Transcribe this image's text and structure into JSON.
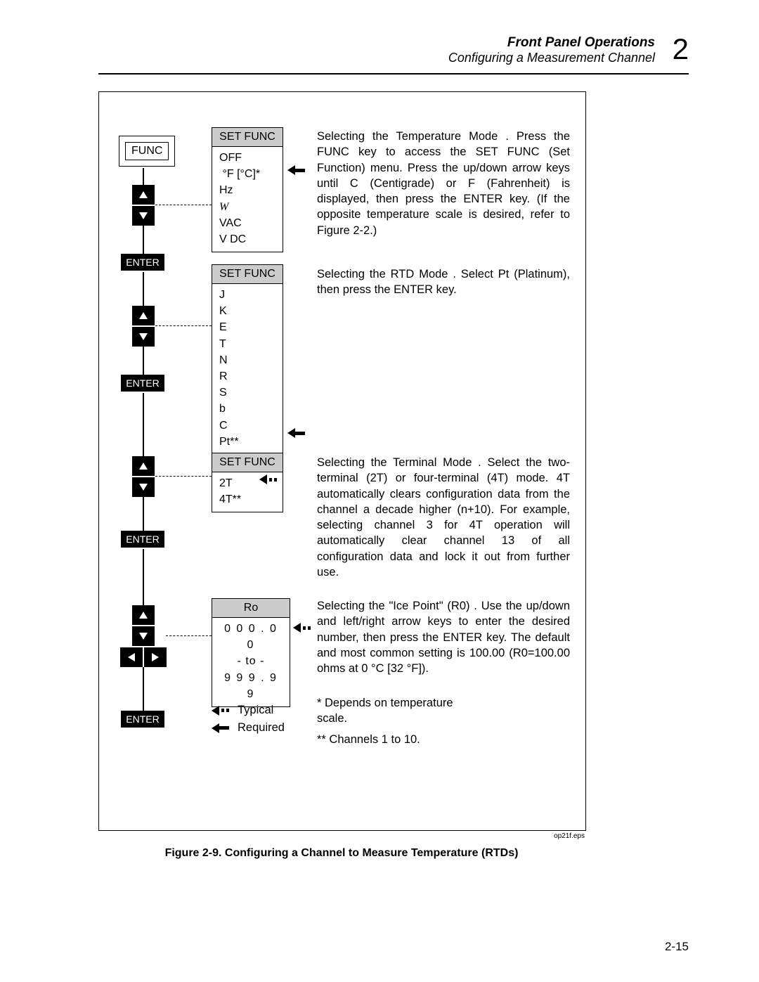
{
  "header": {
    "title": "Front Panel Operations",
    "subtitle": "Configuring a Measurement Channel",
    "chapter": "2"
  },
  "keys": {
    "func": "FUNC",
    "enter": "ENTER"
  },
  "menus": {
    "setfunc_label": "SET FUNC",
    "m1": {
      "items": [
        "OFF",
        "°F [°C]*",
        "Hz",
        "W",
        "VAC",
        "V DC"
      ]
    },
    "m2": {
      "items": [
        "J",
        "K",
        "E",
        "T",
        "N",
        "R",
        "S",
        "b",
        "C",
        "Pt**"
      ]
    },
    "m3": {
      "items": [
        "2T",
        "4T**"
      ]
    },
    "ro": {
      "label": "Ro",
      "top": "0 0 0 . 0 0",
      "mid": "- to -",
      "bot": "9 9 9 . 9 9"
    }
  },
  "desc": {
    "d1": "Selecting the Temperature Mode .  Press the FUNC key to access the SET FUNC (Set Function) menu.  Press the up/down arrow keys until  C (Centigrade) or F (Fahrenheit) is displayed, then press the ENTER key.  (If the opposite temperature scale is desired, refer to Figure 2-2.)",
    "d2": "Selecting the RTD Mode .  Select Pt (Platinum), then press the ENTER key.",
    "d3": "Selecting the Terminal Mode .  Select the two-terminal (2T) or four-terminal (4T) mode.   4T automatically clears configuration data from the channel a decade higher (n+10).  For example, selecting channel 3 for 4T operation will automatically clear channel 13 of all configuration data and lock it out from further use.",
    "d4": "Selecting the \"Ice Point\" (R0) .  Use the up/down and left/right arrow keys to enter the desired number, then press the ENTER key.  The default and most common setting is 100.00 (R0=100.00 ohms at 0 °C [32 °F]).",
    "note1": "*  Depends on temperature scale.",
    "note2": "**  Channels 1 to 10."
  },
  "legend": {
    "typical": "Typical",
    "required": "Required"
  },
  "caption": "Figure 2-9. Configuring a Channel to Measure Temperature (RTDs)",
  "eps": "op21f.eps",
  "pagenum": "2-15"
}
